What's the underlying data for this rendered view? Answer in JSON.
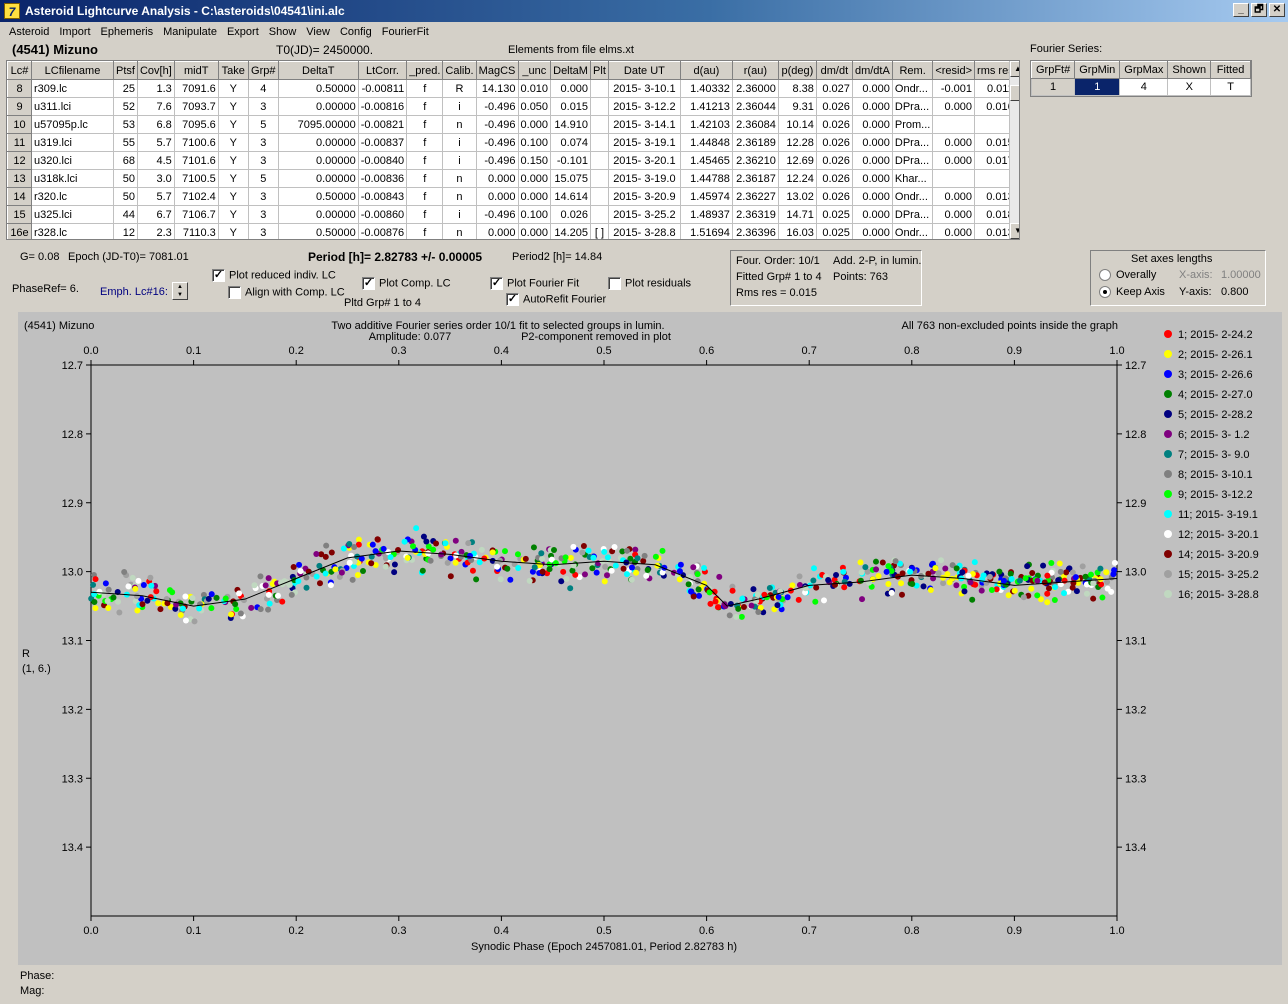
{
  "window": {
    "title": "Asteroid Lightcurve Analysis - C:\\asteroids\\04541\\ini.alc",
    "icon": "app-logo-icon",
    "buttons": [
      "_",
      "🗗",
      "✕"
    ]
  },
  "menu": [
    "Asteroid",
    "Import",
    "Ephemeris",
    "Manipulate",
    "Export",
    "Show",
    "View",
    "Config",
    "FourierFit"
  ],
  "header": {
    "asteroid": "(4541) Mizuno",
    "t0": "T0(JD)= 2450000.",
    "elements": "Elements from file elms.xt",
    "fourier_label": "Fourier Series:"
  },
  "table": {
    "columns": [
      "Lc#",
      "LCfilename",
      "Ptsf",
      "Cov[h]",
      "midT",
      "Take",
      "Grp#",
      "DeltaT",
      "LtCorr.",
      "_pred.",
      "Calib.",
      "MagCS",
      "_unc",
      "DeltaM",
      "Plt",
      "Date UT",
      "d(au)",
      "r(au)",
      "p(deg)",
      "dm/dt",
      "dm/dtA",
      "Rem.",
      "<resid>",
      "rms res"
    ],
    "rows": [
      [
        "8",
        "r309.lc",
        "25",
        "1.3",
        "7091.6",
        "Y",
        "4",
        "0.50000",
        "-0.00811",
        "f",
        "R",
        "14.130",
        "0.010",
        "0.000",
        "",
        "2015- 3-10.1",
        "1.40332",
        "2.36000",
        "8.38",
        "0.027",
        "0.000",
        "Ondr...",
        "-0.001",
        "0.011"
      ],
      [
        "9",
        "u311.lci",
        "52",
        "7.6",
        "7093.7",
        "Y",
        "3",
        "0.00000",
        "-0.00816",
        "f",
        "i",
        "-0.496",
        "0.050",
        "0.015",
        "",
        "2015- 3-12.2",
        "1.41213",
        "2.36044",
        "9.31",
        "0.026",
        "0.000",
        "DPra...",
        "0.000",
        "0.016"
      ],
      [
        "10",
        "u57095p.lc",
        "53",
        "6.8",
        "7095.6",
        "Y",
        "5",
        "7095.00000",
        "-0.00821",
        "f",
        "n",
        "-0.496",
        "0.000",
        "14.910",
        "",
        "2015- 3-14.1",
        "1.42103",
        "2.36084",
        "10.14",
        "0.026",
        "0.000",
        "Prom...",
        "",
        ""
      ],
      [
        "11",
        "u319.lci",
        "55",
        "5.7",
        "7100.6",
        "Y",
        "3",
        "0.00000",
        "-0.00837",
        "f",
        "i",
        "-0.496",
        "0.100",
        "0.074",
        "",
        "2015- 3-19.1",
        "1.44848",
        "2.36189",
        "12.28",
        "0.026",
        "0.000",
        "DPra...",
        "0.000",
        "0.015"
      ],
      [
        "12",
        "u320.lci",
        "68",
        "4.5",
        "7101.6",
        "Y",
        "3",
        "0.00000",
        "-0.00840",
        "f",
        "i",
        "-0.496",
        "0.150",
        "-0.101",
        "",
        "2015- 3-20.1",
        "1.45465",
        "2.36210",
        "12.69",
        "0.026",
        "0.000",
        "DPra...",
        "0.000",
        "0.017"
      ],
      [
        "13",
        "u318k.lci",
        "50",
        "3.0",
        "7100.5",
        "Y",
        "5",
        "0.00000",
        "-0.00836",
        "f",
        "n",
        "0.000",
        "0.000",
        "15.075",
        "",
        "2015- 3-19.0",
        "1.44788",
        "2.36187",
        "12.24",
        "0.026",
        "0.000",
        "Khar...",
        "",
        ""
      ],
      [
        "14",
        "r320.lc",
        "50",
        "5.7",
        "7102.4",
        "Y",
        "3",
        "0.50000",
        "-0.00843",
        "f",
        "n",
        "0.000",
        "0.000",
        "14.614",
        "",
        "2015- 3-20.9",
        "1.45974",
        "2.36227",
        "13.02",
        "0.026",
        "0.000",
        "Ondr...",
        "0.000",
        "0.013"
      ],
      [
        "15",
        "u325.lci",
        "44",
        "6.7",
        "7106.7",
        "Y",
        "3",
        "0.00000",
        "-0.00860",
        "f",
        "i",
        "-0.496",
        "0.100",
        "0.026",
        "",
        "2015- 3-25.2",
        "1.48937",
        "2.36319",
        "14.71",
        "0.025",
        "0.000",
        "DPra...",
        "0.000",
        "0.018"
      ],
      [
        "16e",
        "r328.lc",
        "12",
        "2.3",
        "7110.3",
        "Y",
        "3",
        "0.50000",
        "-0.00876",
        "f",
        "n",
        "0.000",
        "0.000",
        "14.205",
        "[ ]",
        "2015- 3-28.8",
        "1.51694",
        "2.36396",
        "16.03",
        "0.025",
        "0.000",
        "Ondr...",
        "0.000",
        "0.013"
      ]
    ]
  },
  "fourier_table": {
    "columns": [
      "GrpFt#",
      "GrpMin",
      "GrpMax",
      "Shown",
      "Fitted"
    ],
    "row": [
      "1",
      "1",
      "4",
      "X",
      "T"
    ]
  },
  "controls": {
    "g": "G= 0.08",
    "epoch": "Epoch (JD-T0)= 7081.01",
    "period": "Period [h]= 2.82783 +/- 0.00005",
    "period2": "Period2 [h]= 14.84",
    "phaseref": "PhaseRef= 6.",
    "emph": "Emph. Lc#16:",
    "cb_reduced": "Plot reduced indiv. LC",
    "cb_align": "Align with Comp. LC",
    "cb_comp": "Plot Comp. LC",
    "pltd": "Pltd Grp#  1   to   4",
    "cb_fourier": "Plot Fourier Fit",
    "cb_autorefit": "AutoRefit Fourier",
    "cb_residuals": "Plot residuals",
    "checks": {
      "reduced": true,
      "align": false,
      "comp": true,
      "fourier": true,
      "autorefit": true,
      "residuals": false
    }
  },
  "fit_info": {
    "order": "Four. Order: 10/1",
    "add": "Add. 2-P, in lumin.",
    "fitted": "Fitted Grp# 1 to 4",
    "points": "Points: 763",
    "rms": "Rms res      = 0.015"
  },
  "axes_panel": {
    "title": "Set axes lengths",
    "overall": "Overally",
    "keep": "Keep Axis",
    "xaxis_label": "X-axis:",
    "xaxis_value": "1.00000",
    "yaxis_label": "Y-axis:",
    "yaxis_value": "0.800",
    "selected": "keep"
  },
  "chart_data": {
    "type": "scatter",
    "title": "Two additive Fourier series order 10/1 fit to selected groups in lumin.",
    "subtitle_left": "Amplitude: 0.077",
    "subtitle_right": "P2-component removed in plot",
    "corner_left": "(4541) Mizuno",
    "corner_right": "All 763 non-excluded points inside the graph",
    "xlabel": "Synodic Phase (Epoch 2457081.01, Period 2.82783 h)",
    "ylabel": "R",
    "ylabel2": "(1, 6.)",
    "xlim": [
      0,
      1
    ],
    "ylim": [
      13.5,
      12.7
    ],
    "xticks": [
      "0.0",
      "0.1",
      "0.2",
      "0.3",
      "0.4",
      "0.5",
      "0.6",
      "0.7",
      "0.8",
      "0.9",
      "1.0"
    ],
    "yticks": [
      "12.7",
      "12.8",
      "12.9",
      "13.0",
      "13.1",
      "13.2",
      "13.3",
      "13.4"
    ],
    "yticks_right": [
      "12.7",
      "12.8",
      "12.9",
      "13.0",
      "13.1",
      "13.2",
      "13.3",
      "13.4"
    ],
    "legend_position": "right",
    "fit_curve": {
      "x": [
        0,
        0.05,
        0.1,
        0.15,
        0.2,
        0.25,
        0.3,
        0.35,
        0.4,
        0.45,
        0.5,
        0.55,
        0.6,
        0.62,
        0.65,
        0.7,
        0.75,
        0.8,
        0.85,
        0.9,
        0.95,
        1.0
      ],
      "y": [
        13.03,
        13.035,
        13.05,
        13.04,
        13.01,
        12.98,
        12.97,
        12.975,
        12.985,
        12.99,
        12.985,
        12.99,
        13.02,
        13.05,
        13.04,
        13.02,
        13.015,
        13.005,
        13.01,
        13.02,
        13.015,
        13.01
      ]
    },
    "series": [
      {
        "name": "1; 2015- 2-24.2",
        "color": "#ff0000"
      },
      {
        "name": "2; 2015- 2-26.1",
        "color": "#ffff00"
      },
      {
        "name": "3; 2015- 2-26.6",
        "color": "#0000ff"
      },
      {
        "name": "4; 2015- 2-27.0",
        "color": "#008000"
      },
      {
        "name": "5; 2015- 2-28.2",
        "color": "#000080"
      },
      {
        "name": "6; 2015- 3- 1.2",
        "color": "#800080"
      },
      {
        "name": "7; 2015- 3- 9.0",
        "color": "#008080"
      },
      {
        "name": "8; 2015- 3-10.1",
        "color": "#808080"
      },
      {
        "name": "9; 2015- 3-12.2",
        "color": "#00ff00"
      },
      {
        "name": "11; 2015- 3-19.1",
        "color": "#00ffff"
      },
      {
        "name": "12; 2015- 3-20.1",
        "color": "#ffffff"
      },
      {
        "name": "14; 2015- 3-20.9",
        "color": "#800000"
      },
      {
        "name": "15; 2015- 3-25.2",
        "color": "#a0a0a0"
      },
      {
        "name": "16; 2015- 3-28.8",
        "color": "#c0d8c0"
      }
    ]
  },
  "status": {
    "phase": "Phase:",
    "mag": "Mag:"
  }
}
